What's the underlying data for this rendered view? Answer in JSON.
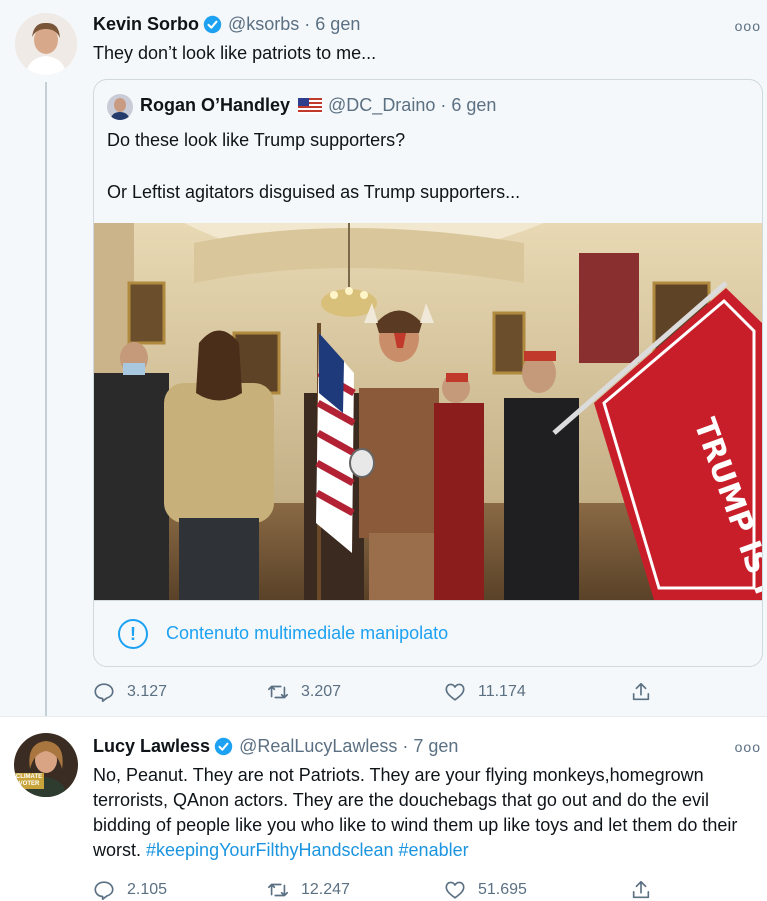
{
  "tweet1": {
    "name": "Kevin Sorbo",
    "handle": "@ksorbs · 6 gen",
    "text": "They don’t look like patriots to me...",
    "more": "ooo",
    "quote": {
      "name": "Rogan O’Handley",
      "handle": "@DC_Draino · 6 gen",
      "line1": "Do these look like Trump supporters?",
      "line2": "Or Leftist agitators disguised as Trump supporters...",
      "flag_lettering": "TRUMP IS MY PRESIDENT",
      "warning_icon": "!",
      "warning": "Contenuto multimediale manipolato"
    },
    "stats": {
      "replies": "3.127",
      "retweets": "3.207",
      "likes": "11.174"
    }
  },
  "tweet2": {
    "name": "Lucy Lawless",
    "handle": "@RealLucyLawless · 7 gen",
    "more": "ooo",
    "avatar_badge": "CLIMATE\nVOTER",
    "text": "No, Peanut. They are not Patriots. They are your flying monkeys,homegrown terrorists, QAnon actors. They are the douchebags that go out and do the evil bidding of people like you who like to wind them up like toys and let them do their worst. ",
    "hashtag1": "#keepingYourFilthyHandsclean",
    "hashtag2": "#enabler",
    "stats": {
      "replies": "2.105",
      "retweets": "12.247",
      "likes": "51.695"
    }
  },
  "colors": {
    "accent": "#1da1f2",
    "secondary": "#5b7083",
    "verified": "#1da1f2"
  },
  "icons": [
    "verified-badge-icon",
    "more-options-icon",
    "reply-icon",
    "retweet-icon",
    "like-icon",
    "share-icon",
    "alert-icon",
    "us-flag-icon"
  ]
}
